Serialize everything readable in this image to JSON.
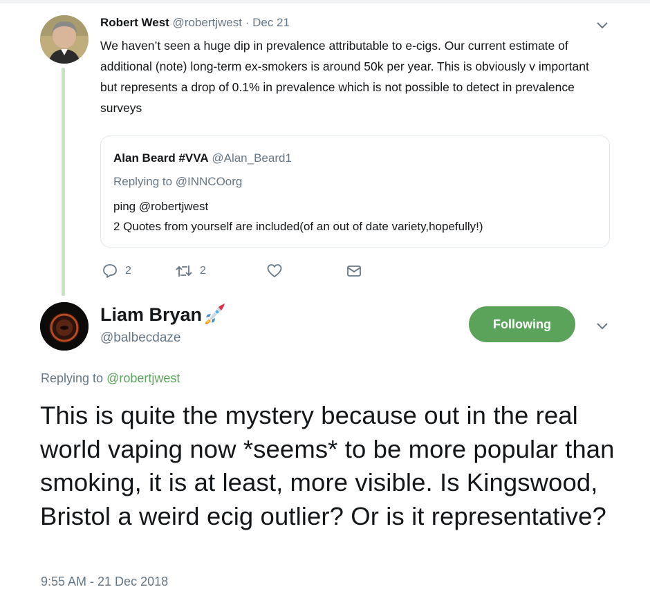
{
  "parent_tweet": {
    "author_name": "Robert West",
    "author_handle": "@robertjwest",
    "separator": "·",
    "date": "Dec 21",
    "text": "We haven’t seen a huge dip in prevalence attributable to e-cigs. Our current estimate of additional (note) long-term ex-smokers is around 50k per year. This is obviously v important but represents a drop of 0.1% in prevalence which is not possible to detect in prevalence surveys",
    "quoted_tweet": {
      "author_name": "Alan Beard #VVA",
      "author_handle": "@Alan_Beard1",
      "replying_to": "Replying to @INNCOorg",
      "line1": "ping @robertjwest",
      "line2": " 2 Quotes from yourself are included(of an out of date variety,hopefully!)"
    },
    "actions": {
      "reply_count": "2",
      "retweet_count": "2",
      "reply_icon": "reply-icon",
      "retweet_icon": "retweet-icon",
      "like_icon": "heart-icon",
      "dm_icon": "envelope-icon"
    }
  },
  "main_tweet": {
    "author_name": "Liam Bryan",
    "author_emoji": "rocket-icon",
    "author_handle": "@balbecdaze",
    "follow_button": "Following",
    "replying_prefix": "Replying to ",
    "replying_mention": "@robertjwest",
    "text": "This is quite the mystery because out in the real world vaping now *seems* to be more popular than smoking, it is at least, more visible. Is Kingswood, Bristol a weird ecig outlier? Or is it representative?",
    "timestamp": "9:55 AM - 21 Dec 2018"
  },
  "colors": {
    "accent_green": "#5ba35a",
    "thread_line": "#c4e4c2",
    "muted_text": "#657786",
    "primary_text": "#14171a"
  }
}
